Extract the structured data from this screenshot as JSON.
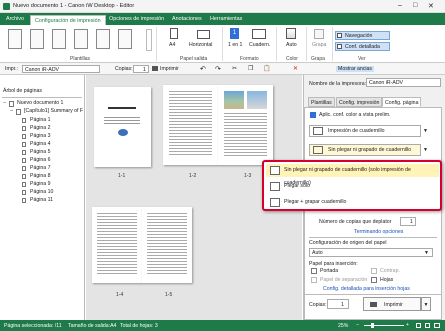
{
  "window": {
    "title": "Nuevo documento 1 - Canon iW Desktop - Editor",
    "controls": {
      "minimize": "–",
      "maximize": "□",
      "close": "✕"
    }
  },
  "menu": [
    "Archivo",
    "Configuración de impresión",
    "Opciones de impresión",
    "Anotaciones",
    "Herramientas"
  ],
  "ribbon": {
    "groups": [
      "Plantillas",
      "Papel salida",
      "Formato",
      "Color",
      "Grapa",
      "Ver"
    ],
    "paper": "A4",
    "orientation": "Horizontal",
    "layout": "1 en 1",
    "cuadern": "Cuadern.",
    "color": "Auto",
    "grapa": "Grapa",
    "nav": "Navegación",
    "conf": "Conf. detallada"
  },
  "toolbar": {
    "impr_label": "Impr.:",
    "printer": "Canon iR-ADV",
    "copias_label": "Copias:",
    "copias": "1",
    "imprimir": "Imprimir",
    "mostrar": "Mostrar ancias"
  },
  "tree": {
    "title": "Árbol de páginas",
    "root": "Nuevo documento 1",
    "child": "[Capítulo1] Summary of F",
    "pages": [
      "Página 1",
      "Página 2",
      "Página 3",
      "Página 4",
      "Página 5",
      "Página 6",
      "Página 7",
      "Página 8",
      "Página 9",
      "Página 10",
      "Página 11"
    ]
  },
  "preview": {
    "labels": [
      "1-1",
      "1-2",
      "1-3",
      "1-4",
      "1-5"
    ],
    "doc_title": "Summary of Manual"
  },
  "right": {
    "printer_label": "Nombre de la impresora:",
    "printer": "Canon iR-ADV",
    "tabs": [
      "Plantillas",
      "Config. impresión",
      "Config. página"
    ],
    "color_check": "Aplic. conf. color a vista prelim.",
    "booklet": "Impresión de cuadernillo",
    "folding": "Sin plegar ni grapado de cuadernillo",
    "copies_label": "Número de copias que deplator",
    "copies": "1",
    "finish_link": "Terminando opciones",
    "origin_label": "Configuración de origen del papel",
    "origin": "Auto",
    "insert_label": "Papel para inserción:",
    "portada": "Portada",
    "contrap": "Contrap.",
    "separador": "Papel de separación",
    "hojas": "Hojas",
    "detail_link": "Config. detallada para inserción hojas",
    "copias_label": "Copias:",
    "copias": "1",
    "imprimir": "Imprimir"
  },
  "popup": {
    "items": [
      "Sin plegar ni grapado de cuadernillo (solo impresión de cuadernillo)",
      "Plegar sólo",
      "Plegar + grapar cuadernillo"
    ]
  },
  "status": {
    "selected": "Página seleccionada: /11",
    "size": "Tamaño de salida:A4",
    "total": "Total de hojas: 3",
    "zoom": "25%"
  }
}
